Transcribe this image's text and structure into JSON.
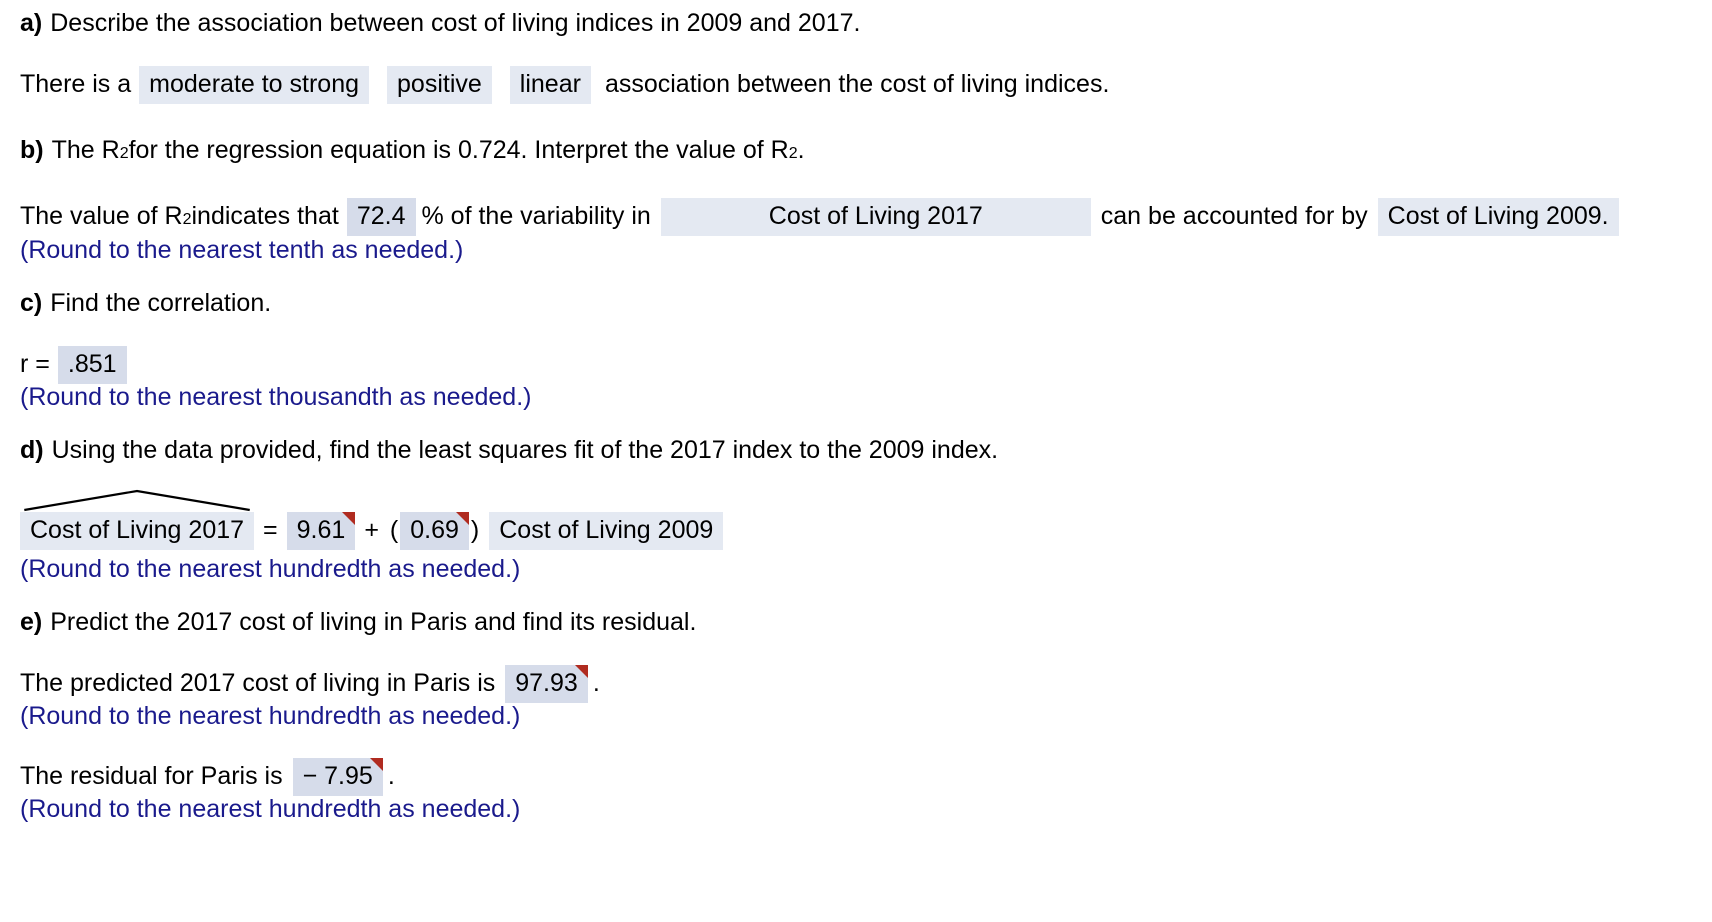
{
  "questions": {
    "a": {
      "marker": "a)",
      "prompt": "Describe the association between cost of living indices in 2009 and 2017.",
      "answer_prefix": "There is a",
      "dropdown_strength": "moderate to strong",
      "dropdown_direction": "positive",
      "dropdown_form": "linear",
      "answer_suffix": "association between the cost of living indices."
    },
    "b": {
      "marker": "b)",
      "prompt_part1": "The R",
      "prompt_sup1": "2",
      "prompt_part2": " for the regression equation is 0.724. Interpret the value of R",
      "prompt_sup2": "2",
      "prompt_part3": ".",
      "answer_part1": "The value of R",
      "answer_sup": "2",
      "answer_part2": " indicates that",
      "percent_value": "72.4",
      "answer_part3": "% of the variability in",
      "dropdown_response": "Cost of Living 2017",
      "answer_part4": "can be accounted for by",
      "dropdown_explanatory": "Cost of Living 2009.",
      "rounding_note": "(Round to the nearest tenth as needed.)"
    },
    "c": {
      "marker": "c)",
      "prompt": "Find the correlation.",
      "r_label": "r =",
      "r_value": ".851",
      "rounding_note": "(Round to the nearest thousandth as needed.)"
    },
    "d": {
      "marker": "d)",
      "prompt": "Using the data provided, find the least squares fit of the 2017 index to the 2009 index.",
      "response_var": "Cost of Living 2017",
      "equals": "=",
      "intercept": "9.61",
      "plus": "+",
      "open_paren": "(",
      "slope": "0.69",
      "close_paren": ")",
      "explanatory_var": "Cost of Living 2009",
      "rounding_note": "(Round to the nearest hundredth as needed.)"
    },
    "e": {
      "marker": "e)",
      "prompt": "Predict the 2017 cost of living in Paris and find its residual.",
      "predicted_prefix": "The predicted 2017 cost of living in Paris is",
      "predicted_value": "97.93",
      "predicted_period": ".",
      "predicted_note": "(Round to the nearest hundredth as needed.)",
      "residual_prefix": "The residual for Paris is",
      "residual_value": "− 7.95",
      "residual_period": ".",
      "residual_note": "(Round to the nearest hundredth as needed.)"
    }
  },
  "colors": {
    "dropdown_bg": "#e4e9f2",
    "input_bg": "#d6dcea",
    "flag_red": "#b02b20",
    "note_blue": "#1a1a8c"
  }
}
